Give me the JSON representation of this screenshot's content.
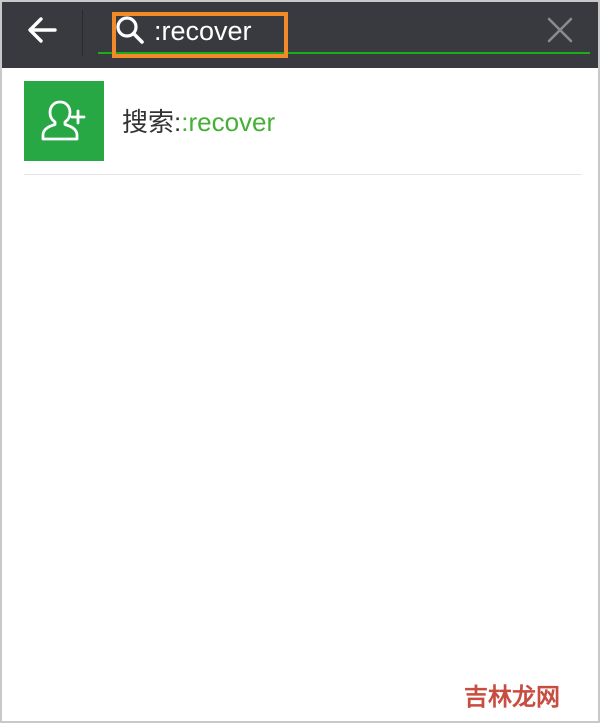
{
  "header": {
    "back_icon": "arrow-left-icon",
    "search_icon": "search-icon",
    "clear_icon": "close-icon",
    "search_value": ":recover",
    "accent_color": "#1aad19",
    "highlight_color": "#f28a2a"
  },
  "results": [
    {
      "icon": "add-contact-icon",
      "icon_bg": "#28a745",
      "prefix": "搜索:",
      "keyword": ":recover"
    }
  ],
  "watermark": {
    "text": "吉林龙网"
  }
}
